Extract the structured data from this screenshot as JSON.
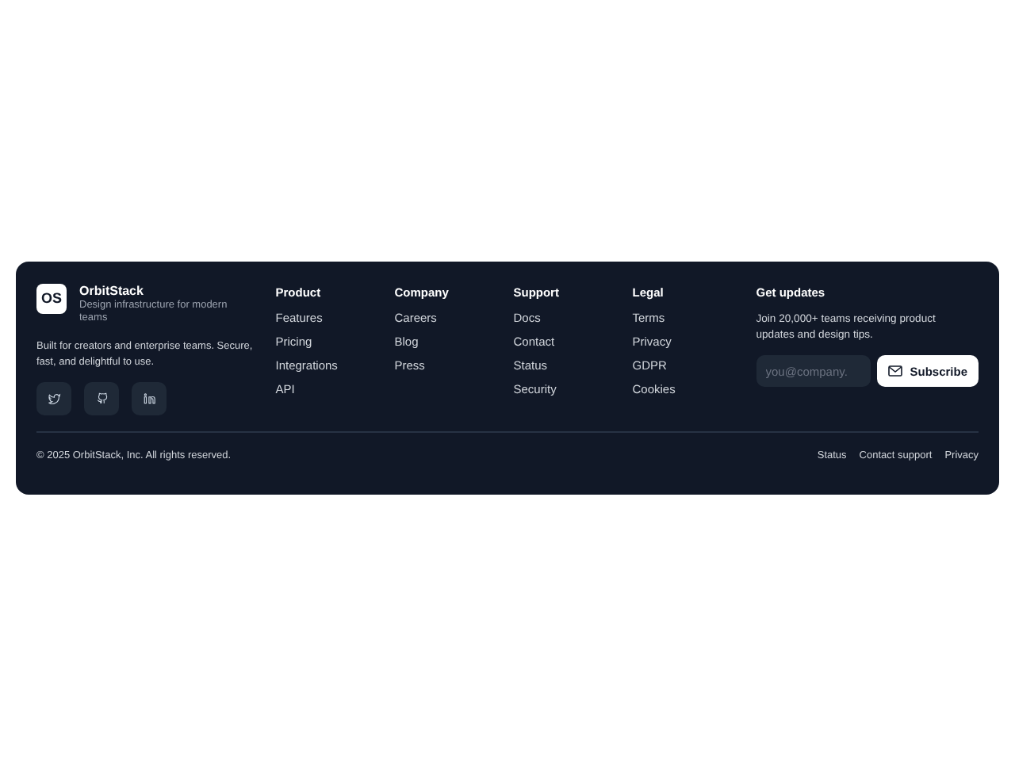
{
  "brand": {
    "logo": "OS",
    "name": "OrbitStack",
    "tagline": "Design infrastructure for modern teams",
    "description": "Built for creators and enterprise teams. Secure, fast, and delightful to use.",
    "social": [
      {
        "kind": "twitter"
      },
      {
        "kind": "github"
      },
      {
        "kind": "linkedin"
      }
    ]
  },
  "columns": [
    {
      "title": "Product",
      "links": [
        "Features",
        "Pricing",
        "Integrations",
        "API"
      ]
    },
    {
      "title": "Company",
      "links": [
        "Careers",
        "Blog",
        "Press"
      ]
    },
    {
      "title": "Support",
      "links": [
        "Docs",
        "Contact",
        "Status",
        "Security"
      ]
    },
    {
      "title": "Legal",
      "links": [
        "Terms",
        "Privacy",
        "GDPR",
        "Cookies"
      ]
    }
  ],
  "newsletter": {
    "title": "Get updates",
    "text": "Join 20,000+ teams receiving product updates and design tips.",
    "placeholder": "you@company.",
    "button": "Subscribe"
  },
  "bottom": {
    "copyright": "© 2025 OrbitStack, Inc. All rights reserved.",
    "links": [
      "Status",
      "Contact support",
      "Privacy"
    ]
  }
}
